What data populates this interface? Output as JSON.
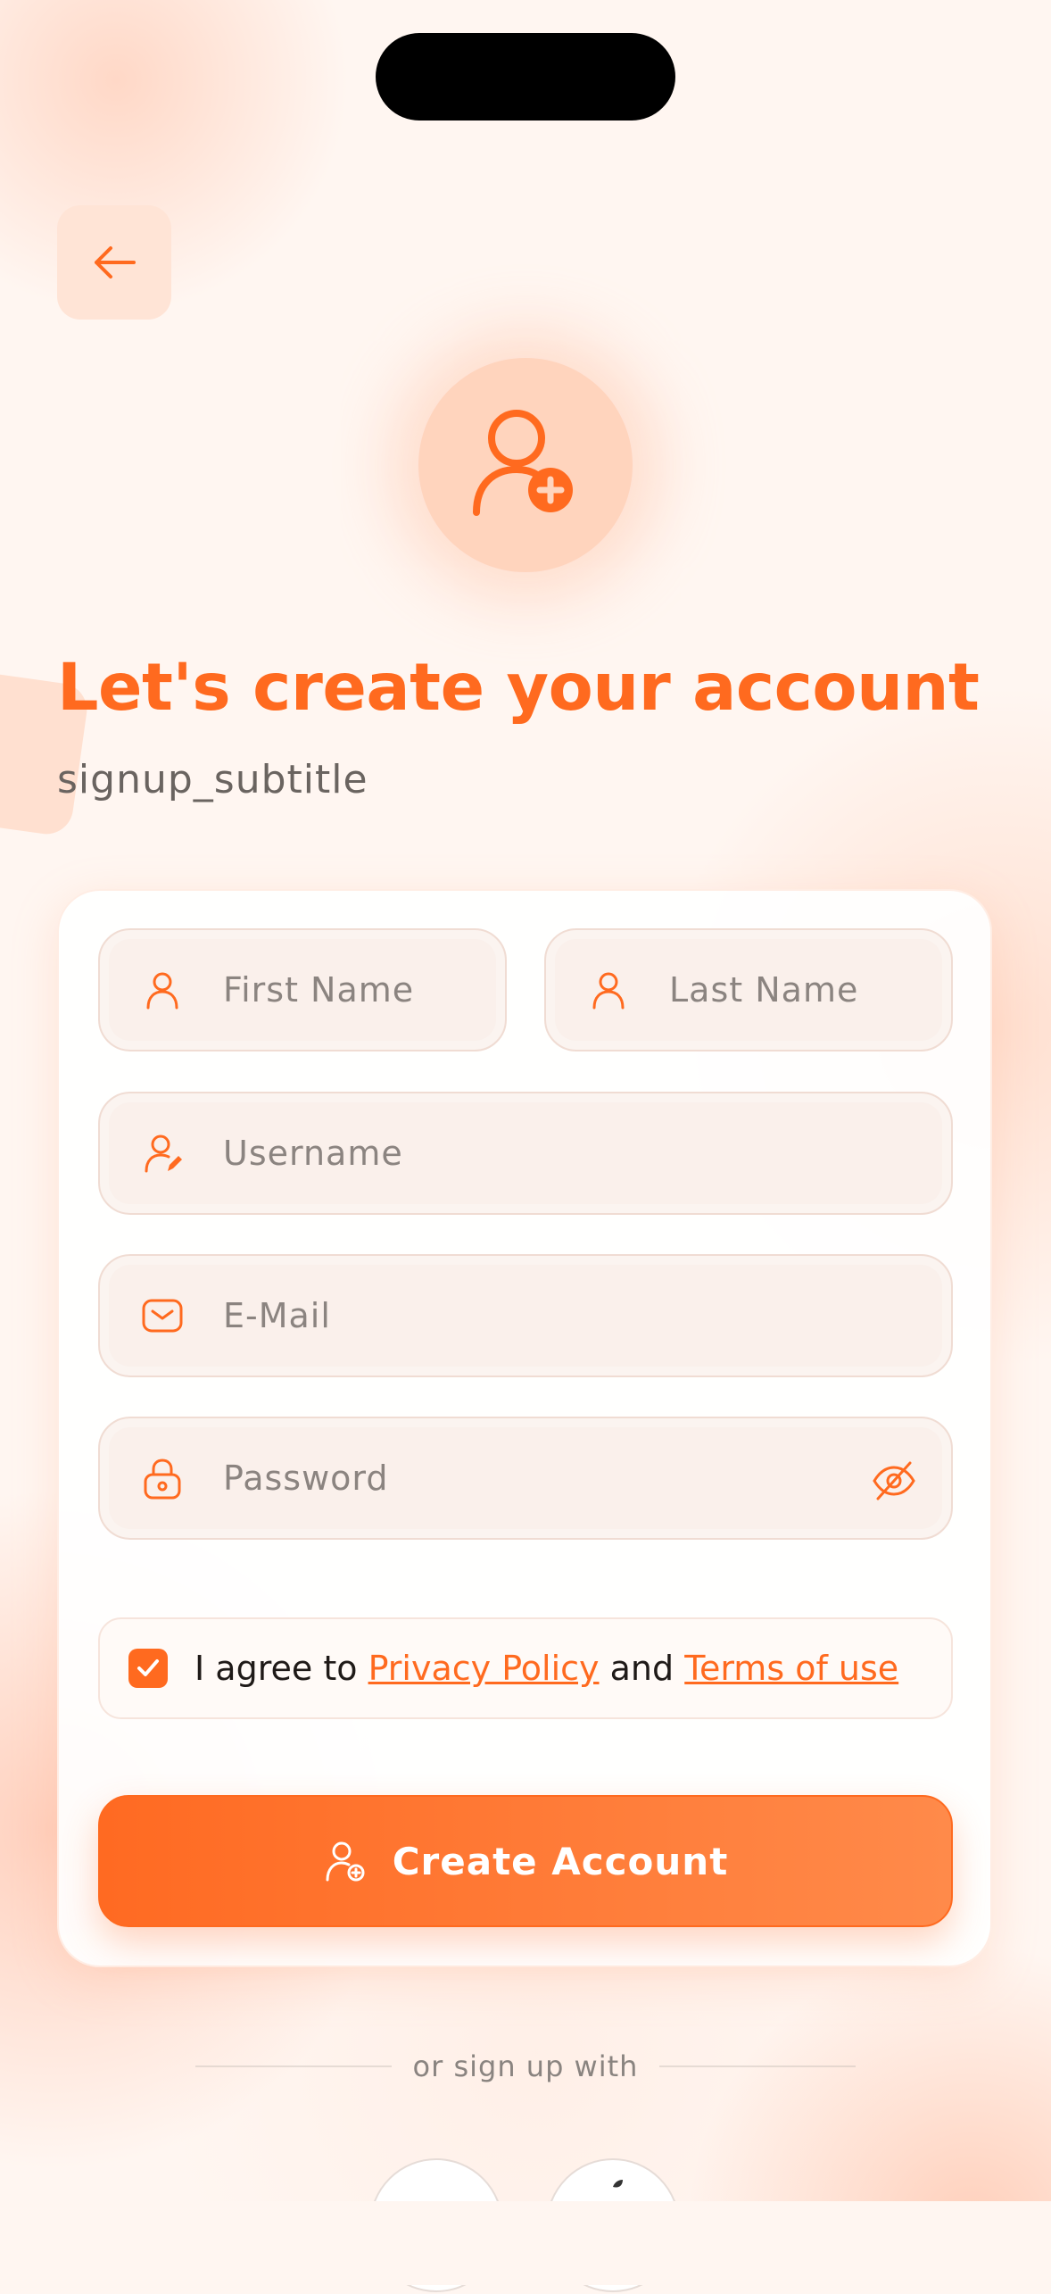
{
  "header": {
    "back_icon": "arrow-left-icon"
  },
  "hero": {
    "icon": "user-add-icon",
    "title": "Let's create your account",
    "subtitle": "signup_subtitle"
  },
  "form": {
    "first_name": {
      "placeholder": "First Name",
      "value": "",
      "icon": "user-icon"
    },
    "last_name": {
      "placeholder": "Last Name",
      "value": "",
      "icon": "user-icon"
    },
    "username": {
      "placeholder": "Username",
      "value": "",
      "icon": "user-edit-icon"
    },
    "email": {
      "placeholder": "E-Mail",
      "value": "",
      "icon": "mail-icon"
    },
    "password": {
      "placeholder": "Password",
      "value": "",
      "icon": "lock-icon",
      "toggle_icon": "eye-off-icon"
    },
    "agreement": {
      "checked": true,
      "prefix": "I agree to",
      "privacy_link": "Privacy Policy",
      "middle": "and",
      "terms_link": "Terms of use"
    },
    "submit_label": "Create Account"
  },
  "social": {
    "divider_text": "or sign up with"
  },
  "colors": {
    "accent": "#ff6a1f",
    "background": "#fff6f1"
  }
}
